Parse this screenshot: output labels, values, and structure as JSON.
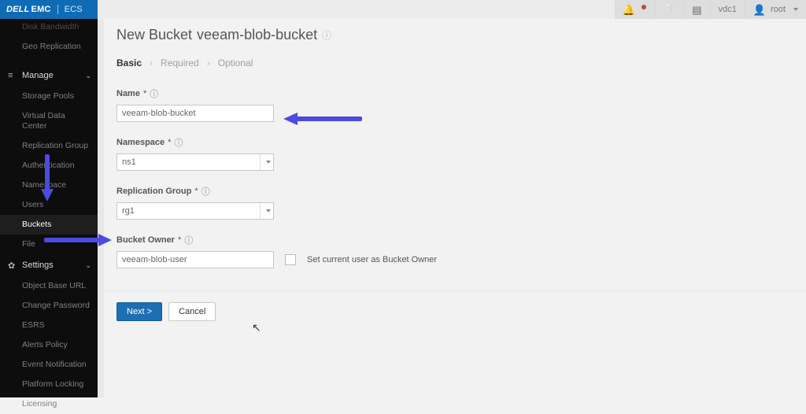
{
  "brand": {
    "dell": "DELL",
    "emc": "EMC",
    "product": "ECS"
  },
  "header": {
    "vdc_label": "vdc1",
    "user_label": "root"
  },
  "nav": {
    "top_items": [
      {
        "label": "Disk Bandwidth"
      },
      {
        "label": "Geo Replication"
      }
    ],
    "manage_label": "Manage",
    "manage_items": [
      {
        "label": "Storage Pools",
        "name": "sidebar-item-storage-pools"
      },
      {
        "label": "Virtual Data Center",
        "name": "sidebar-item-vdc"
      },
      {
        "label": "Replication Group",
        "name": "sidebar-item-replication-group"
      },
      {
        "label": "Authentication",
        "name": "sidebar-item-authentication"
      },
      {
        "label": "Namespace",
        "name": "sidebar-item-namespace"
      },
      {
        "label": "Users",
        "name": "sidebar-item-users"
      },
      {
        "label": "Buckets",
        "name": "sidebar-item-buckets"
      },
      {
        "label": "File",
        "name": "sidebar-item-file"
      }
    ],
    "settings_label": "Settings",
    "settings_items": [
      {
        "label": "Object Base URL",
        "name": "sidebar-item-object-base-url"
      },
      {
        "label": "Change Password",
        "name": "sidebar-item-change-password"
      },
      {
        "label": "ESRS",
        "name": "sidebar-item-esrs"
      },
      {
        "label": "Alerts Policy",
        "name": "sidebar-item-alerts-policy"
      },
      {
        "label": "Event Notification",
        "name": "sidebar-item-event-notification"
      },
      {
        "label": "Platform Locking",
        "name": "sidebar-item-platform-locking"
      },
      {
        "label": "Licensing",
        "name": "sidebar-item-licensing"
      }
    ]
  },
  "page": {
    "title_prefix": "New Bucket",
    "title_object": "veeam-blob-bucket"
  },
  "wizard": {
    "step1": "Basic",
    "step2": "Required",
    "step3": "Optional"
  },
  "form": {
    "name_label": "Name",
    "name_value": "veeam-blob-bucket",
    "namespace_label": "Namespace",
    "namespace_value": "ns1",
    "replication_label": "Replication Group",
    "replication_value": "rg1",
    "owner_label": "Bucket Owner",
    "owner_value": "veeam-blob-user",
    "owner_checkbox_label": "Set current user as Bucket Owner"
  },
  "actions": {
    "next": "Next >",
    "cancel": "Cancel"
  }
}
